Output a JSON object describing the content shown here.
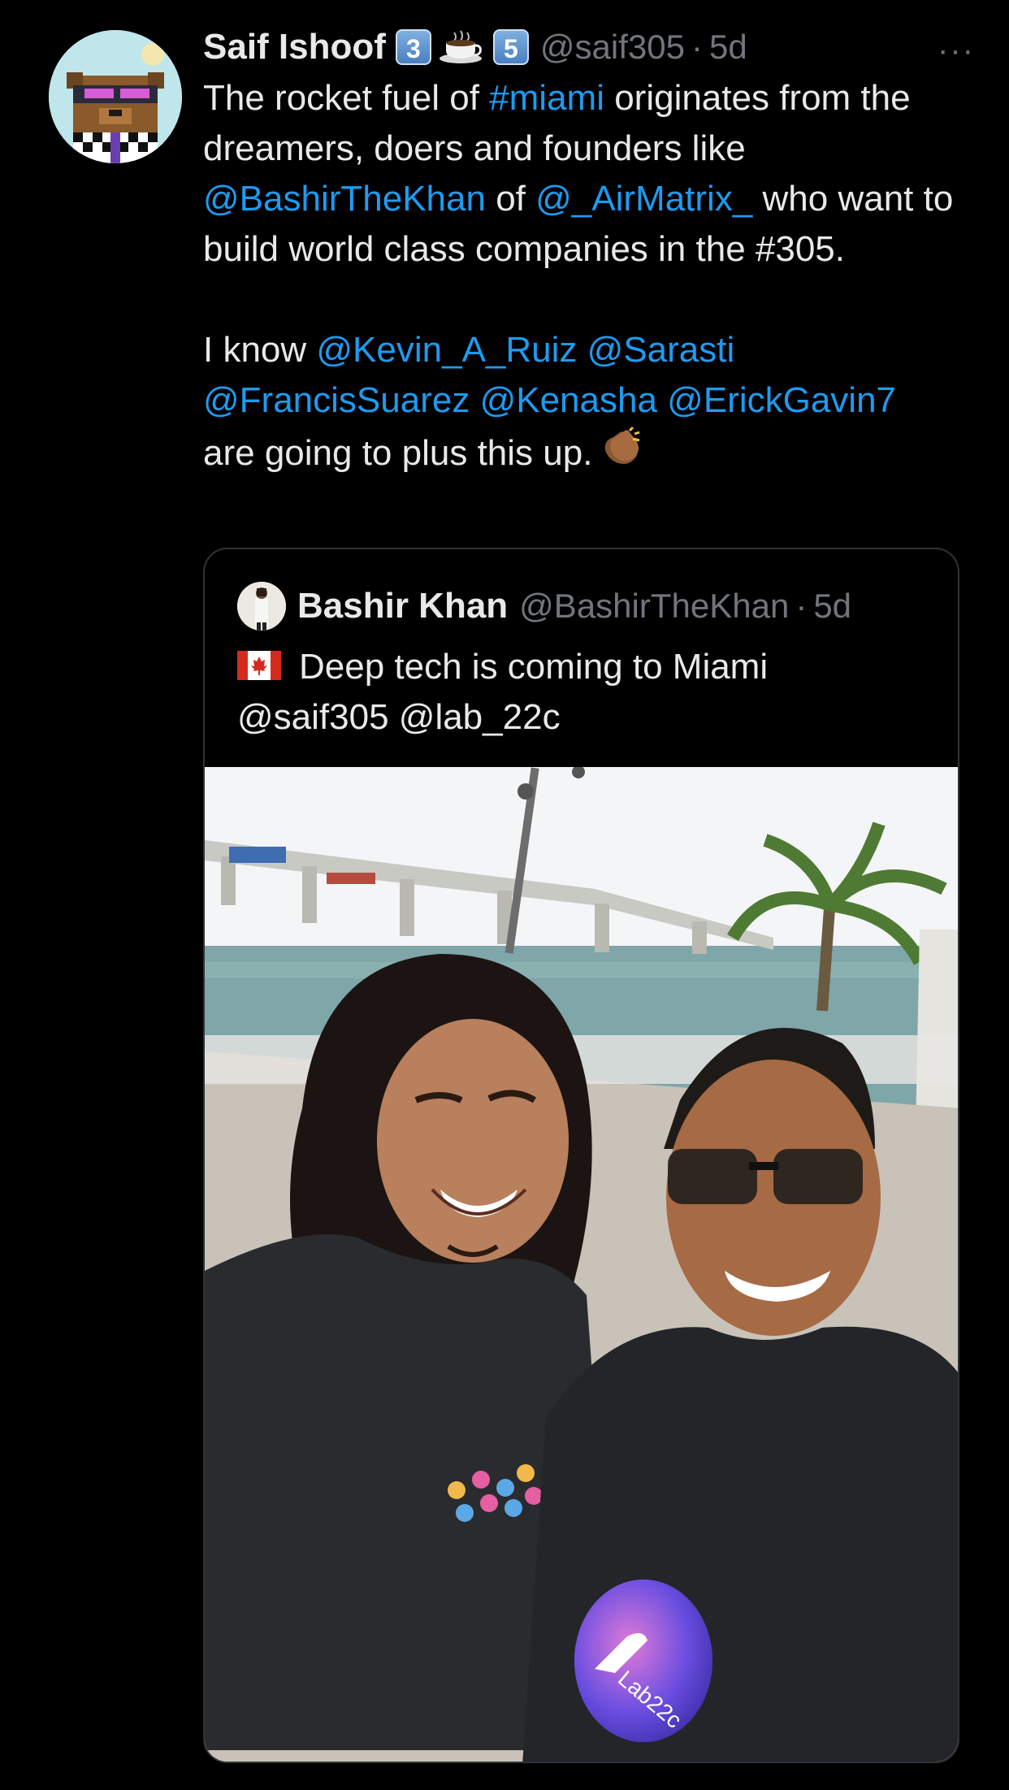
{
  "tweet": {
    "author_name": "Saif Ishoof",
    "badge_left": "3",
    "badge_right": "5",
    "handle": "@saif305",
    "time": "5d",
    "more_icon": "more-horizontal-icon",
    "text": {
      "p1_a": "The rocket fuel of ",
      "p1_tag": "#miami",
      "p1_b": " originates from the dreamers, doers and founders like ",
      "p1_m1": "@BashirTheKhan",
      "p1_c": " of ",
      "p1_m2": "@_AirMatrix_",
      "p1_d": " who want to build world class companies in the #305.",
      "p2_a": "I know ",
      "p2_m1": "@Kevin_A_Ruiz",
      "p2_m2": "@Sarasti",
      "p2_m3": "@FrancisSuarez",
      "p2_m4": "@Kenasha",
      "p2_m5": "@ErickGavin7",
      "p2_b": "are going to plus this up."
    }
  },
  "quoted": {
    "author_name": "Bashir Khan",
    "handle": "@BashirTheKhan",
    "time": "5d",
    "text_line1": "Deep tech is coming to Miami",
    "text_line2": "@saif305 @lab_22c",
    "photo_shirt_text": "Lab22c"
  },
  "colors": {
    "background": "#000000",
    "link": "#1d9bf0",
    "secondary_text": "#71767b",
    "primary_text": "#e7e9ea"
  }
}
